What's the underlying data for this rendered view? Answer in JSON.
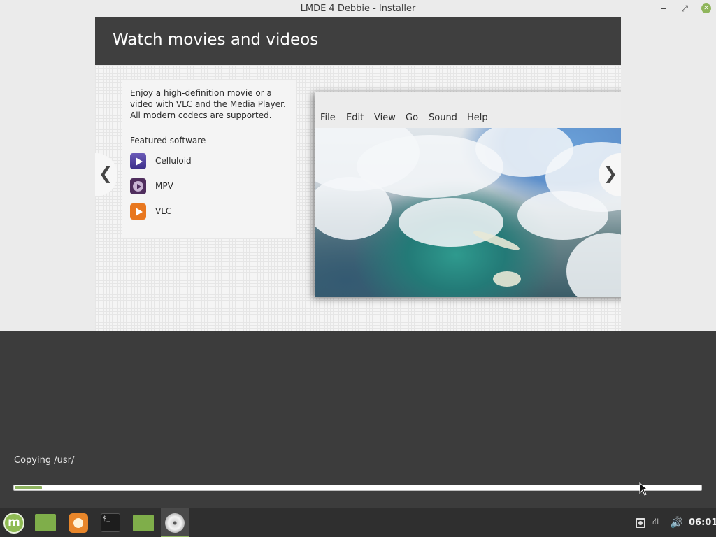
{
  "window": {
    "title": "LMDE 4 Debbie - Installer",
    "minimize_glyph": "‒",
    "maximize_glyph": "⤢"
  },
  "slide": {
    "title": "Watch movies and videos",
    "description": "Enjoy a high-definition movie or a video with VLC and the Media Player. All modern codecs are supported.",
    "featured_title": "Featured software",
    "apps": [
      {
        "name": "Celluloid",
        "icon": "celluloid-icon"
      },
      {
        "name": "MPV",
        "icon": "mpv-icon"
      },
      {
        "name": "VLC",
        "icon": "vlc-icon"
      }
    ],
    "player_menu": [
      "File",
      "Edit",
      "View",
      "Go",
      "Sound",
      "Help"
    ],
    "prev_arrow": "❮",
    "next_arrow": "❯"
  },
  "status": {
    "text": "Copying /usr/",
    "progress_fraction": 0.04
  },
  "taskbar": {
    "items": [
      "menu-icon",
      "show-desktop-icon",
      "firefox-icon",
      "terminal-icon",
      "files-icon",
      "installer-icon"
    ],
    "terminal_prompt": "$_",
    "network_glyph": "⛙",
    "volume_glyph": "🔊",
    "clock": "06:01"
  },
  "colors": {
    "accent": "#8fb461",
    "header": "#3f3f3f",
    "desktop": "#3c3c3c"
  }
}
